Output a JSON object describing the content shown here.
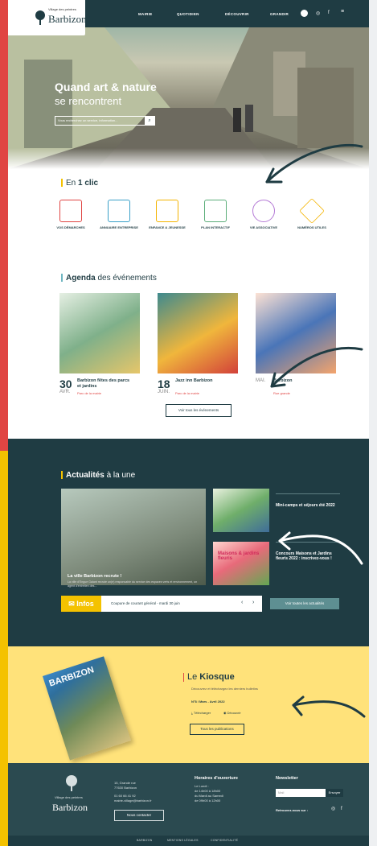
{
  "header": {
    "logo_tagline": "Village des peintres",
    "logo_name": "Barbizon",
    "nav": [
      "MAIRIE",
      "QUOTIDIEN",
      "DÉCOUVRIR",
      "GRANDIR"
    ]
  },
  "hero": {
    "title": "Quand art & nature",
    "subtitle": "se rencontrent",
    "search_placeholder": "Vous recherchez un service, information..."
  },
  "en1clic": {
    "title_normal": "En ",
    "title_bold": "1 clic",
    "items": [
      {
        "label": "VOS DÉMARCHES",
        "icon": "form-icon",
        "color": "#e04543"
      },
      {
        "label": "ANNUAIRE ENTREPRISE",
        "icon": "building-icon",
        "color": "#3aa0c8"
      },
      {
        "label": "ENFANCE & JEUNESSE",
        "icon": "blocks-icon",
        "color": "#f4b400"
      },
      {
        "label": "PLAN INTERACTIF",
        "icon": "map-icon",
        "color": "#5cae7a"
      },
      {
        "label": "VIE ASSOCIATIVE",
        "icon": "racket-icon",
        "color": "#b57bd6"
      },
      {
        "label": "NUMÉROS UTILES",
        "icon": "phone-icon",
        "color": "#f4b400"
      }
    ]
  },
  "agenda": {
    "title_bold": "Agenda",
    "title_normal": " des événements",
    "events": [
      {
        "day": "30",
        "month": "AVR.",
        "title": "Barbizon fêtes des parcs et jardins",
        "place": "Parc de la mairie"
      },
      {
        "day": "18",
        "month": "JUIN.",
        "title": "Jazz inn Barbizon",
        "place": "Parc de la mairie"
      },
      {
        "day": "",
        "month": "MAI.",
        "title": "Barbizon",
        "place": "Rue grande"
      }
    ],
    "all_button": "Voir tous les événements"
  },
  "news": {
    "title_bold": "Actualités",
    "title_normal": " à la une",
    "main_caption": "La ville Barbizon recrute !",
    "main_text": "La ville d'Engue Galant recrute un(e) responsable du service des espaces verts et environnement, un agent d'entretien des...",
    "side_items": [
      "Mini-camps et séjours été 2022",
      "Concours Maisons et Jardins fleuris 2022 : inscrivez-vous !"
    ],
    "card2_text": "Maisons & jardins fleuris",
    "infos_label": "Infos",
    "infos_text": "Coupure de courant général - mardi 30 juin",
    "all_button": "Voir toutes les actualités"
  },
  "kiosque": {
    "mag_title": "BARBIZON",
    "title_normal": "Le ",
    "title_bold": "Kiosque",
    "subtitle": "Découvrez et téléchargez les derniers bulletins",
    "issue": "N°8 / Mars - Avril 2022",
    "download": "Télécharger",
    "view": "Découvrir",
    "all_button": "Tous les publications"
  },
  "footer": {
    "logo_tagline": "Village des peintres",
    "logo_name": "Barbizon",
    "address": [
      "15, Grande rue",
      "77630 Barbizon"
    ],
    "phone": "01 60 66 41 92",
    "email": "mairie-village@barbizon.fr",
    "contact_button": "Nous contacter",
    "hours_title": "Horaires d'ouverture",
    "hours": [
      "Le Lundi :",
      "de 14h00 à 18h00",
      "",
      "du Mardi au Samedi",
      "de 09h00 à 12h00"
    ],
    "newsletter_title": "Newsletter",
    "newsletter_placeholder": "Mail",
    "newsletter_button": "Envoyer",
    "follow": "Retrouvez-nous sur :",
    "links": [
      "BARBIZON",
      "MENTIONS LÉGALES",
      "CONFIDENTIALITÉ"
    ]
  }
}
